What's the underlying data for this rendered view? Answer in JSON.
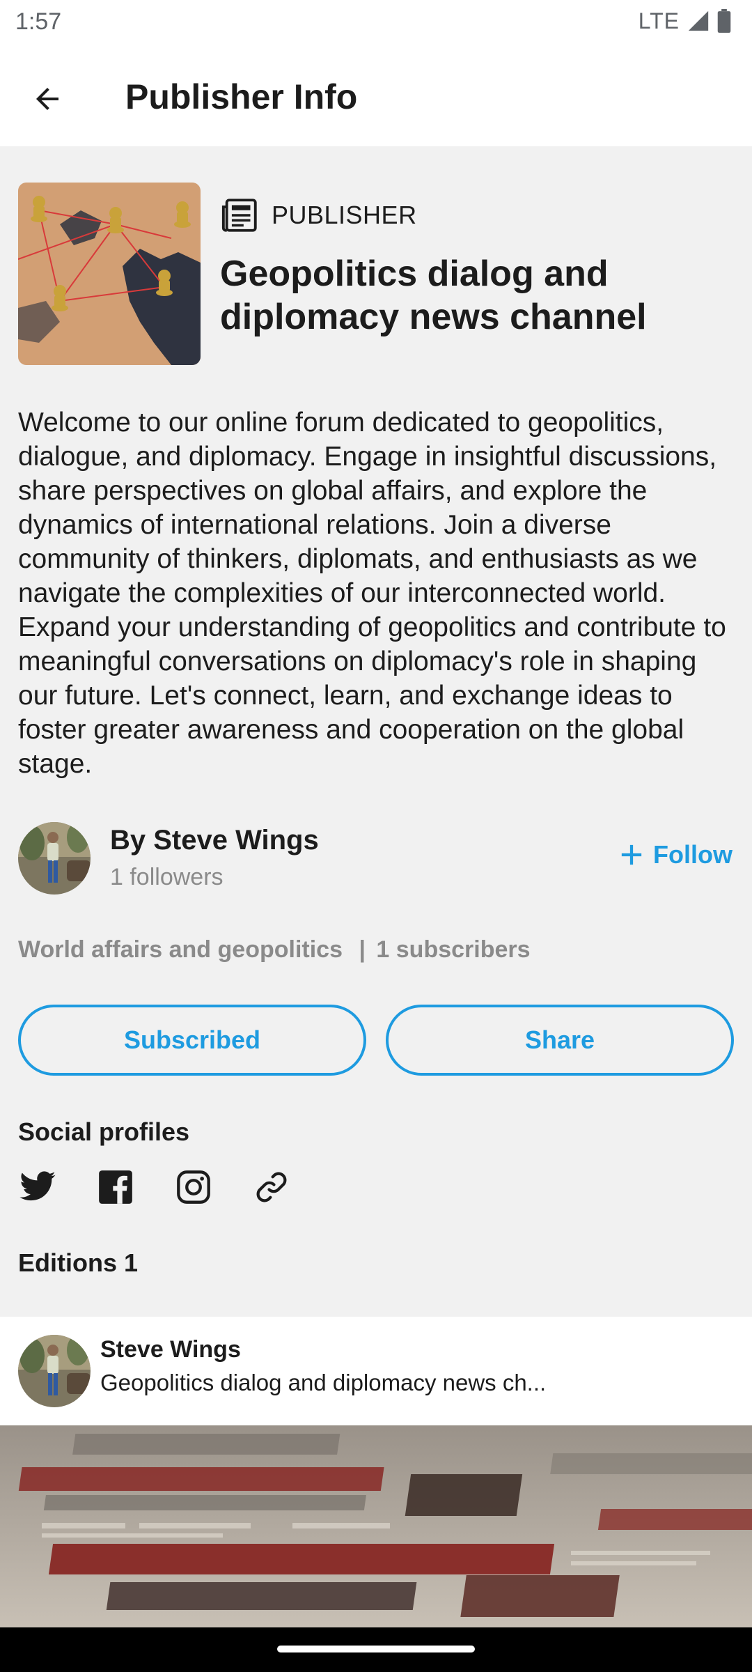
{
  "status_bar": {
    "time": "1:57",
    "network": "LTE",
    "icons": [
      "signal-icon",
      "battery-icon"
    ]
  },
  "app_bar": {
    "title": "Publisher Info",
    "back_icon": "arrow-back-icon"
  },
  "publisher": {
    "label": "PUBLISHER",
    "label_icon": "newspaper-icon",
    "name": "Geopolitics dialog and diplomacy news channel",
    "image": "world-map-chess-image"
  },
  "description": "Welcome to our online forum dedicated to geopolitics, dialogue, and diplomacy. Engage in insightful discussions, share perspectives on global affairs, and explore the dynamics of international relations. Join a diverse community of thinkers, diplomats, and enthusiasts as we navigate the complexities of our interconnected world. Expand your understanding of geopolitics and contribute to meaningful conversations on diplomacy's role in shaping our future. Let's connect, learn, and exchange ideas to foster greater awareness and cooperation on the global stage.",
  "author": {
    "name": "By Steve Wings",
    "followers": "1 followers",
    "follow_label": "Follow"
  },
  "meta": {
    "category": "World affairs and geopolitics",
    "separator": "|",
    "subscribers": "1 subscribers"
  },
  "actions": {
    "subscribed_label": "Subscribed",
    "share_label": "Share"
  },
  "social": {
    "heading": "Social profiles",
    "icons": [
      "twitter-icon",
      "facebook-icon",
      "instagram-icon",
      "link-icon"
    ]
  },
  "editions": {
    "heading": "Editions 1",
    "items": [
      {
        "author": "Steve Wings",
        "title": "Geopolitics dialog and diplomacy news ch...",
        "image": "newspaper-sanctions-image"
      }
    ]
  },
  "colors": {
    "accent": "#1e9be0",
    "background": "#f1f1f1",
    "surface": "#ffffff",
    "muted_text": "#8a8a8a"
  }
}
